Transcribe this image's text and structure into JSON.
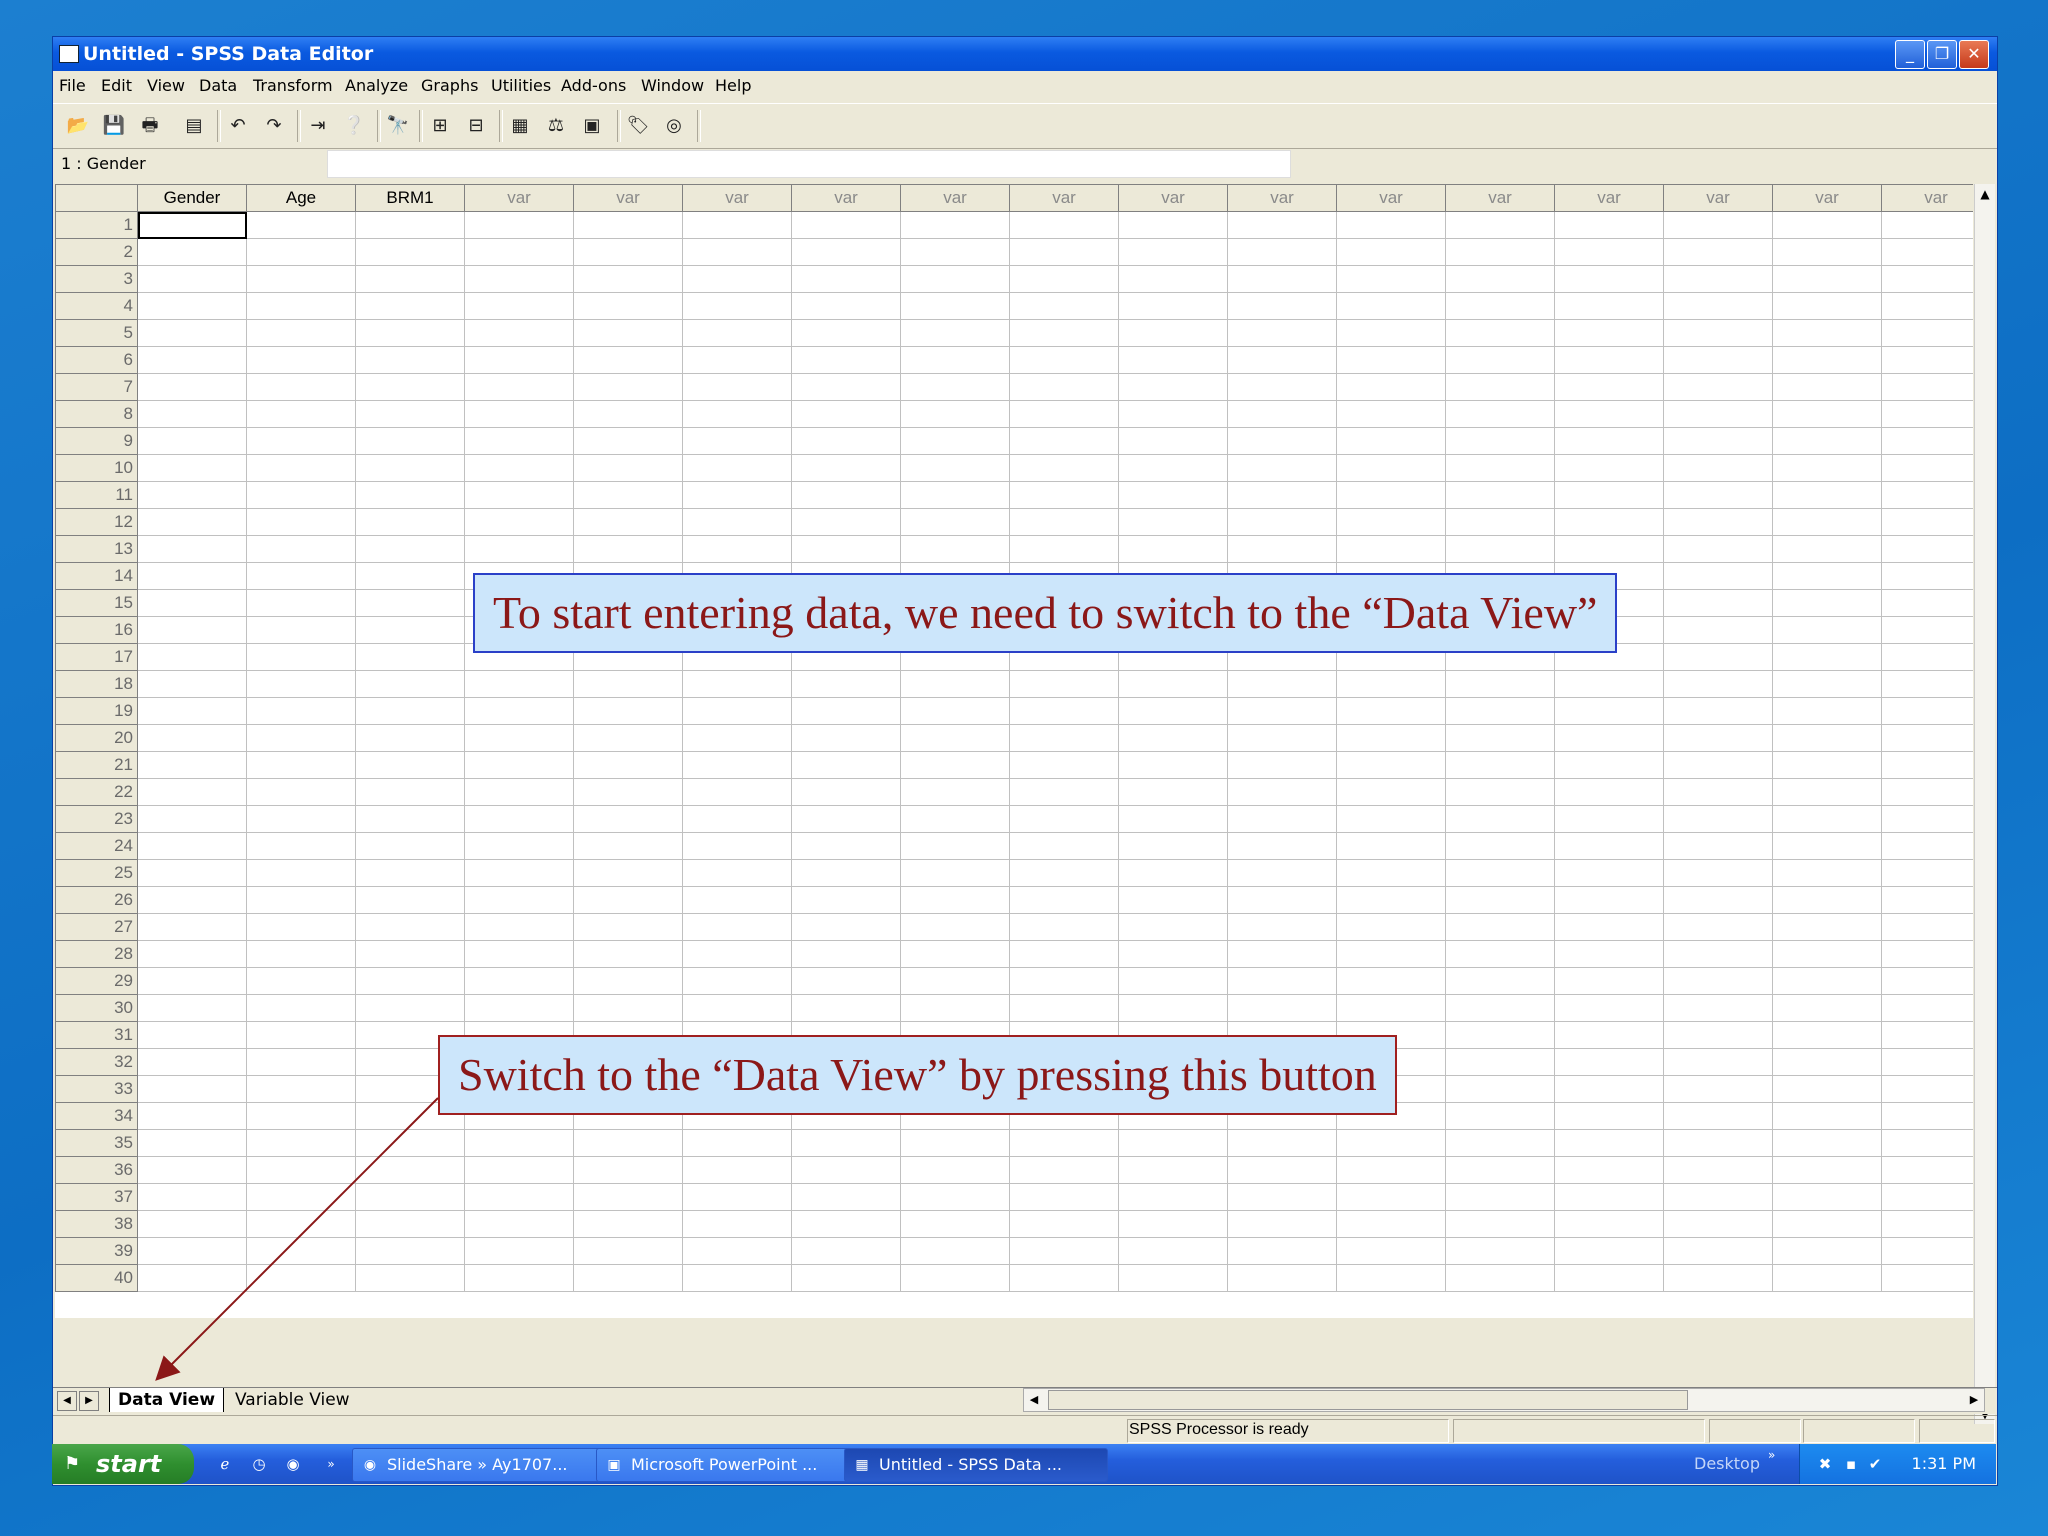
{
  "window": {
    "title": "Untitled - SPSS Data Editor",
    "buttons": {
      "minimize": "_",
      "restore": "❐",
      "close": "✕"
    }
  },
  "menubar": {
    "items": [
      "File",
      "Edit",
      "View",
      "Data",
      "Transform",
      "Analyze",
      "Graphs",
      "Utilities",
      "Add-ons",
      "Window",
      "Help"
    ]
  },
  "toolbar": {
    "icons": [
      "open-icon",
      "save-icon",
      "print-icon",
      "dialog-recall-icon",
      "undo-icon",
      "redo-icon",
      "goto-case-icon",
      "variables-icon",
      "find-icon",
      "insert-cases-icon",
      "insert-variable-icon",
      "split-file-icon",
      "weight-cases-icon",
      "select-cases-icon",
      "value-labels-icon",
      "use-sets-icon"
    ]
  },
  "cell_editor": {
    "reference": "1 : Gender",
    "value": ""
  },
  "grid": {
    "columns": [
      "Gender",
      "Age",
      "BRM1",
      "var",
      "var",
      "var",
      "var",
      "var",
      "var",
      "var",
      "var",
      "var",
      "var",
      "var",
      "var",
      "var",
      "var"
    ],
    "row_count": 40
  },
  "sheet_tabs": {
    "active": "Data View",
    "inactive": "Variable View"
  },
  "statusbar": {
    "text": "SPSS Processor  is ready"
  },
  "taskbar": {
    "start_label": "start",
    "buttons": [
      "SlideShare » Ay1707...",
      "Microsoft PowerPoint ...",
      "Untitled - SPSS Data ..."
    ],
    "desktop_label": "Desktop",
    "chevron": "»",
    "clock": "1:31 PM"
  },
  "callouts": {
    "top": "To start entering data, we need to switch to the “Data View”",
    "bottom": "Switch to the “Data View” by pressing this button"
  },
  "colors": {
    "callout_bg": "#cce6fb",
    "callout_text": "#8b1818",
    "titlebar": "#0a5ae0",
    "desktop": "#0d6ec4"
  }
}
